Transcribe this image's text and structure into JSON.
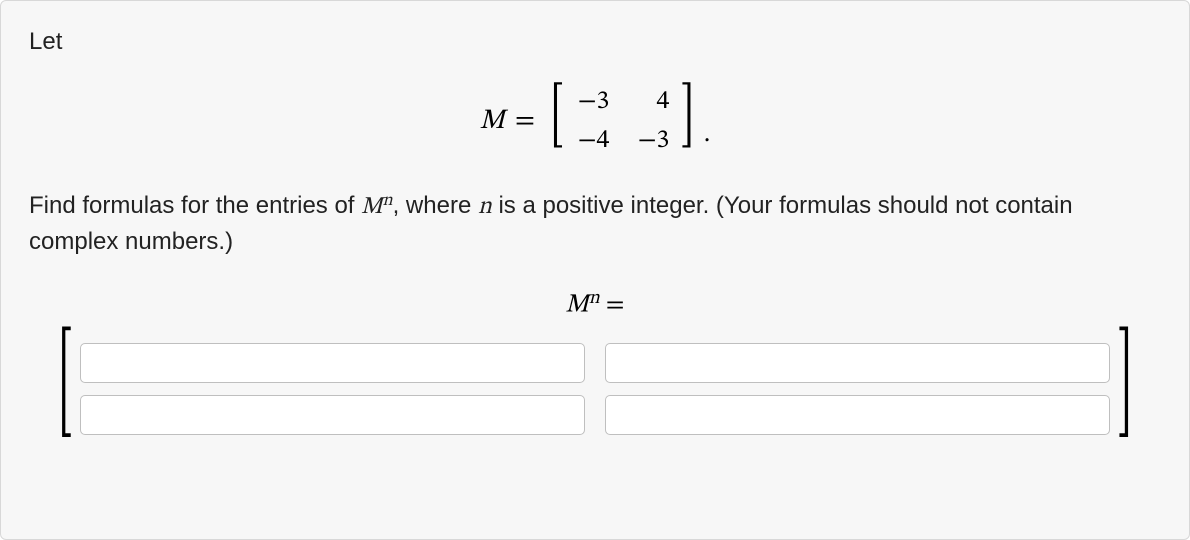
{
  "intro": "Let",
  "matrix_def": {
    "lhs": "M",
    "equals": "=",
    "rows": [
      [
        "−3",
        "4"
      ],
      [
        "−4",
        "−3"
      ]
    ],
    "trailing": "."
  },
  "instruction_parts": {
    "a": "Find formulas for the entries of ",
    "m": "M",
    "sup": "n",
    "b": ", where ",
    "nvar": "n",
    "c": " is a positive integer. (Your formulas should not contain complex numbers.)"
  },
  "result_line": {
    "m": "M",
    "sup": "n",
    "eq": " ="
  },
  "answers": {
    "a11": "",
    "a12": "",
    "a21": "",
    "a22": ""
  }
}
